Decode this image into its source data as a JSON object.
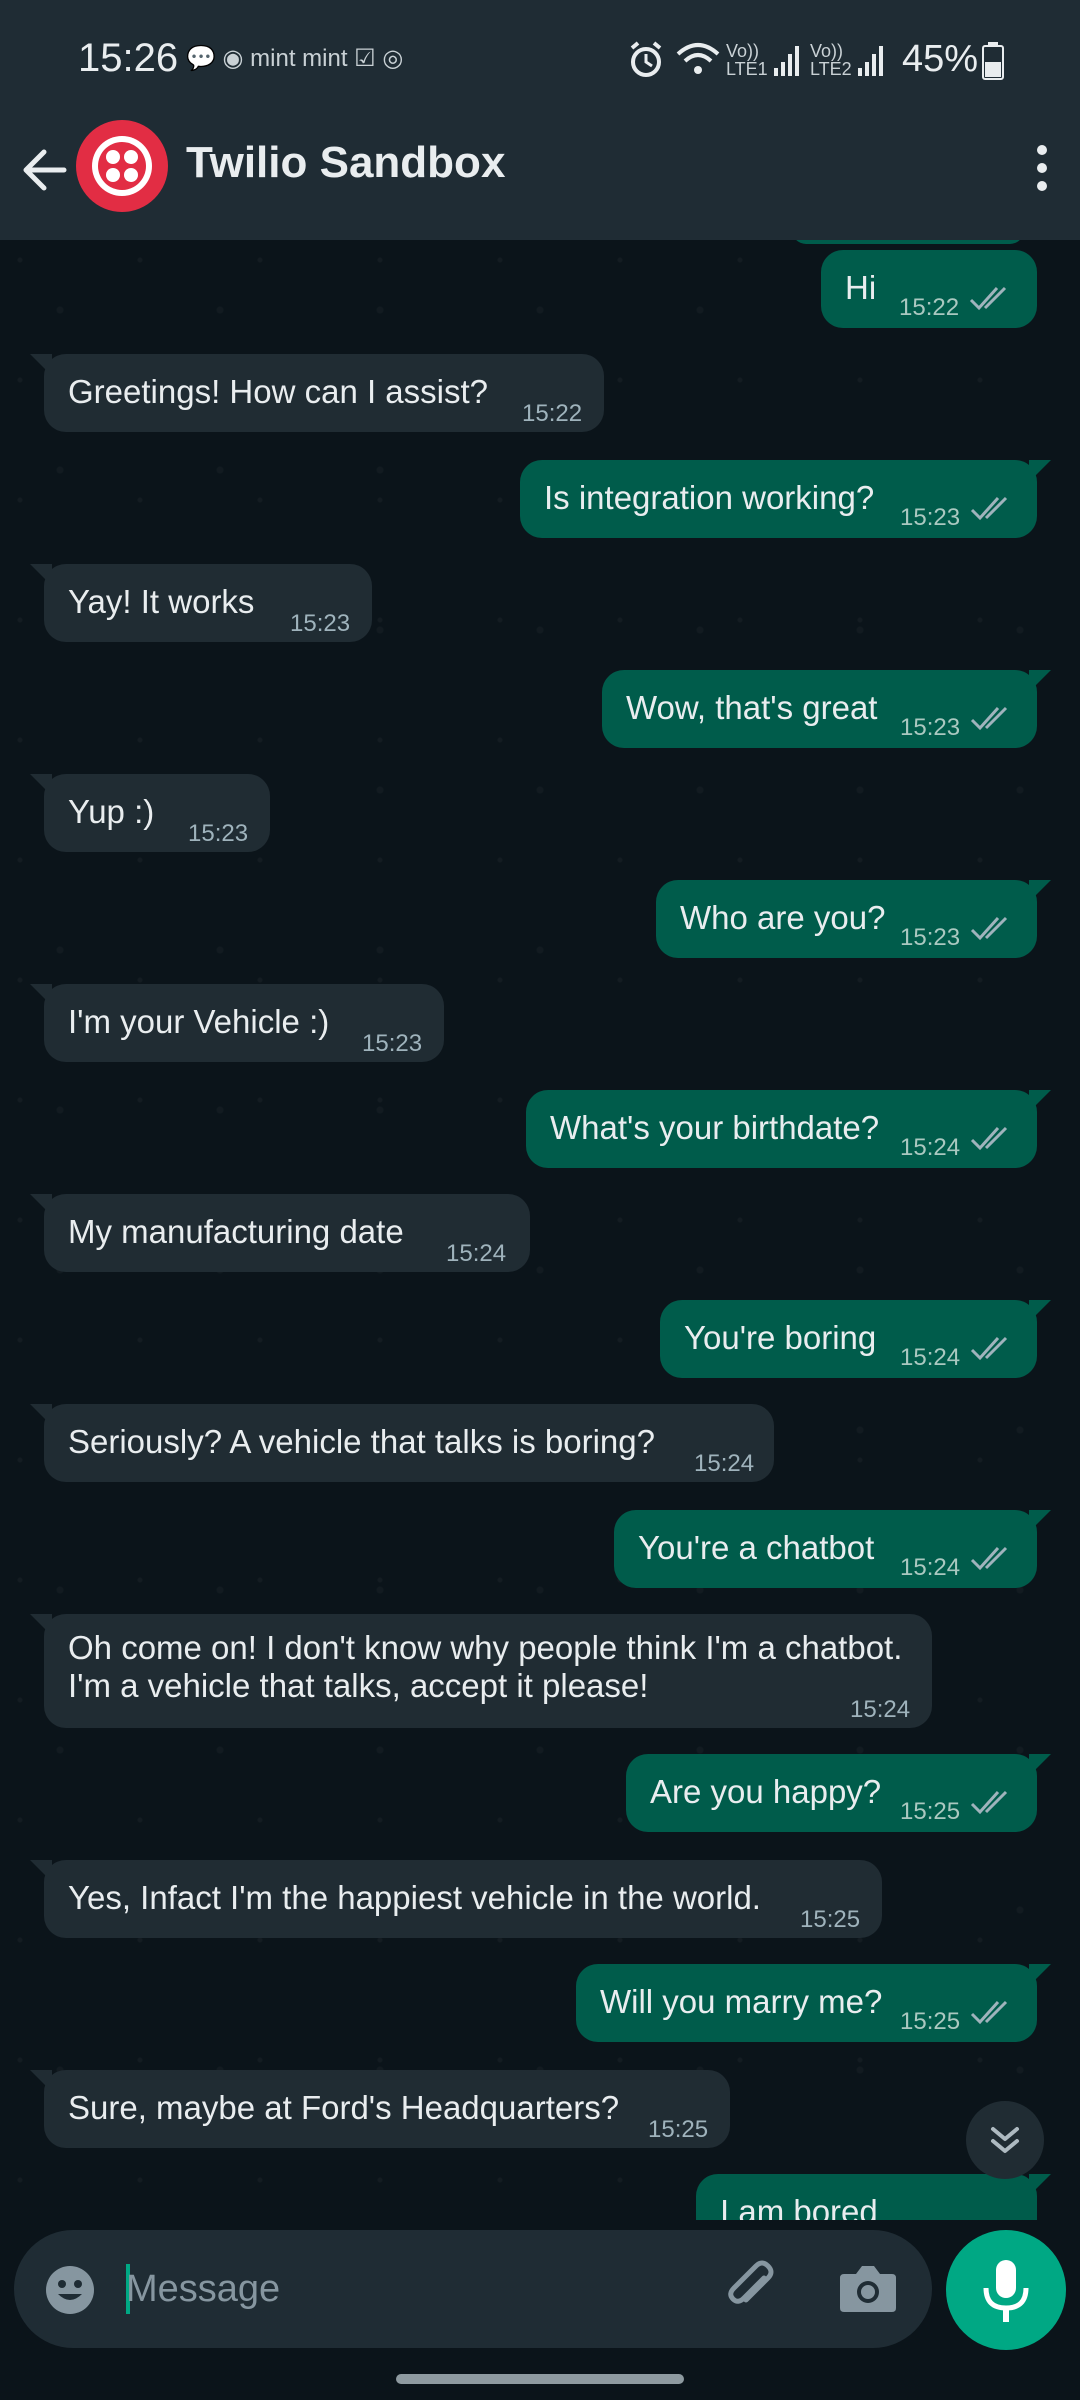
{
  "status": {
    "time": "15:26",
    "notif_icons": "💬 ◉ mint mint ☑ ◎",
    "battery": "45%",
    "sig1": "Vo))\nLTE1",
    "sig2": "Vo))\nLTE2"
  },
  "header": {
    "title": "Twilio Sandbox"
  },
  "messages": [
    {
      "dir": "out",
      "text": "Hi",
      "time": "15:22"
    },
    {
      "dir": "in",
      "text": "Greetings! How can I assist?",
      "time": "15:22"
    },
    {
      "dir": "out",
      "text": "Is integration working?",
      "time": "15:23"
    },
    {
      "dir": "in",
      "text": "Yay! It works",
      "time": "15:23"
    },
    {
      "dir": "out",
      "text": "Wow, that's great",
      "time": "15:23"
    },
    {
      "dir": "in",
      "text": "Yup :)",
      "time": "15:23"
    },
    {
      "dir": "out",
      "text": "Who are you?",
      "time": "15:23"
    },
    {
      "dir": "in",
      "text": "I'm your Vehicle :)",
      "time": "15:23"
    },
    {
      "dir": "out",
      "text": "What's your birthdate?",
      "time": "15:24"
    },
    {
      "dir": "in",
      "text": "My manufacturing date",
      "time": "15:24"
    },
    {
      "dir": "out",
      "text": "You're boring",
      "time": "15:24"
    },
    {
      "dir": "in",
      "text": "Seriously? A vehicle that talks is boring?",
      "time": "15:24"
    },
    {
      "dir": "out",
      "text": "You're a chatbot",
      "time": "15:24"
    },
    {
      "dir": "in",
      "text_line1": "Oh come on! I don't know why people think I'm a chatbot.",
      "text_line2": "I'm a vehicle that talks, accept it please!",
      "time": "15:24"
    },
    {
      "dir": "out",
      "text": "Are you happy?",
      "time": "15:25"
    },
    {
      "dir": "in",
      "text": "Yes, Infact I'm the happiest vehicle in the world.",
      "time": "15:25"
    },
    {
      "dir": "out",
      "text": "Will you marry me?",
      "time": "15:25"
    },
    {
      "dir": "in",
      "text": "Sure, maybe at Ford's Headquarters?",
      "time": "15:25"
    },
    {
      "dir": "out",
      "text": "I am bored",
      "time": ""
    }
  ],
  "composer": {
    "placeholder": "Message"
  },
  "colors": {
    "incoming_bubble": "#202c33",
    "outgoing_bubble": "#005c4b",
    "accent": "#00a884",
    "twilio_red": "#e22d44"
  }
}
